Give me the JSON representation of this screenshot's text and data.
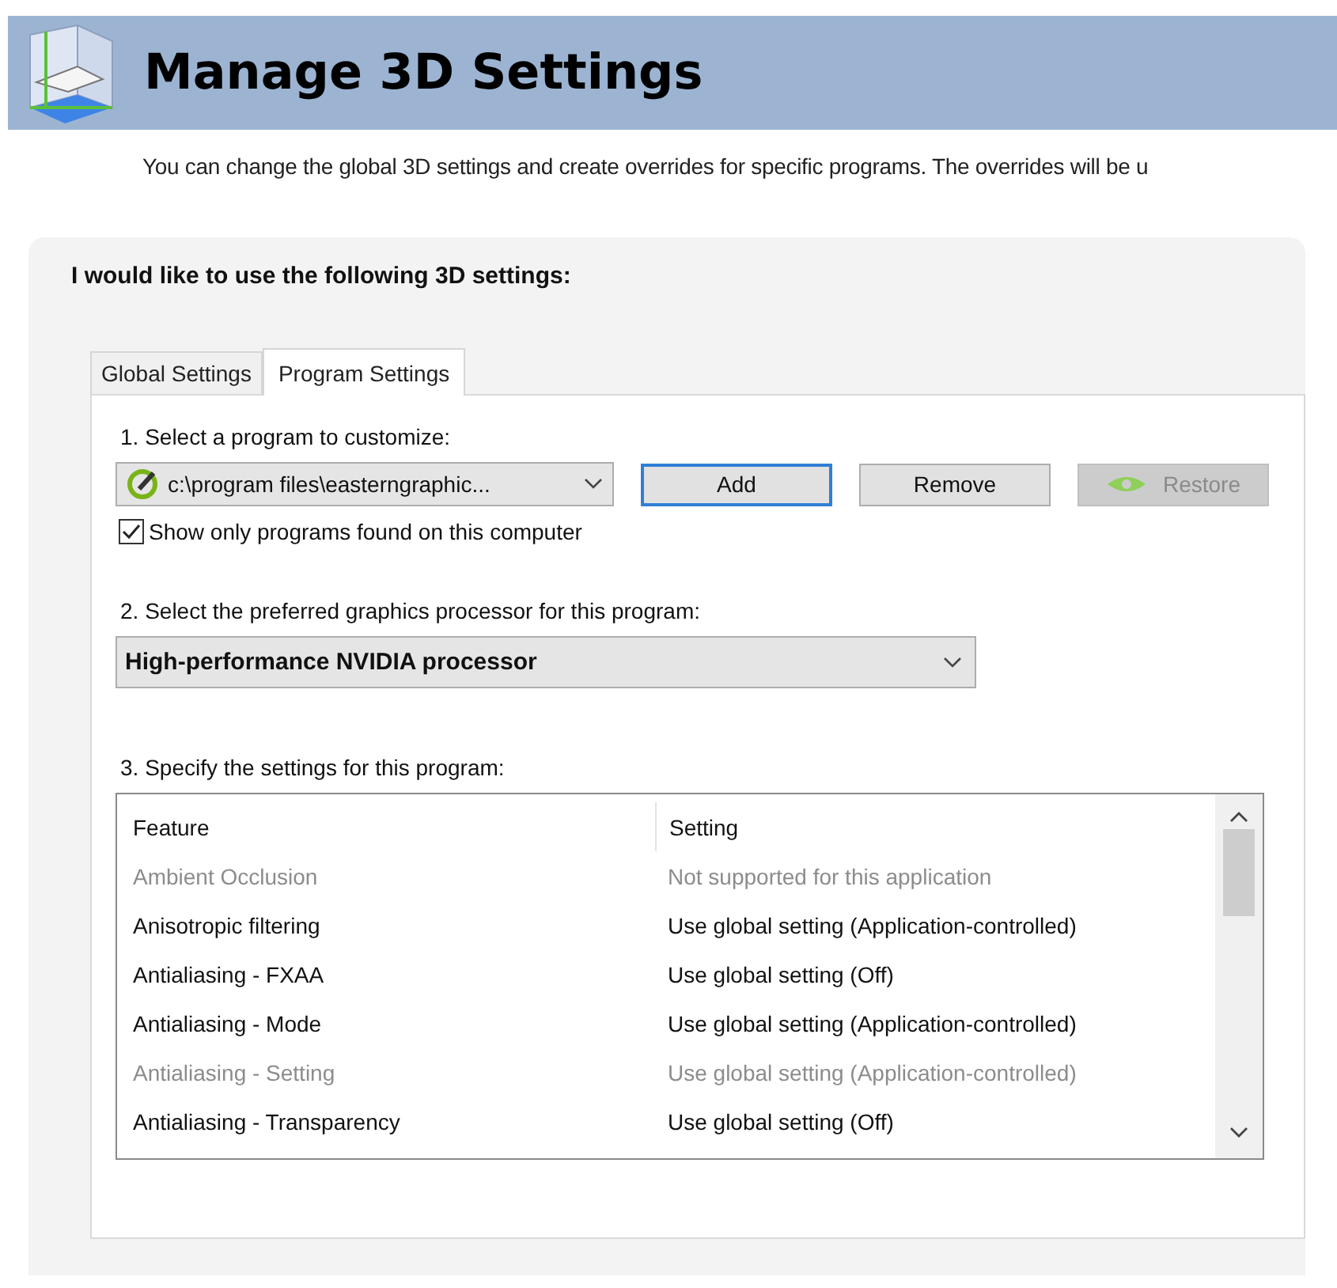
{
  "header": {
    "title": "Manage 3D Settings",
    "description": "You can change the global 3D settings and create overrides for specific programs. The overrides will be u"
  },
  "panel": {
    "heading": "I would like to use the following 3D settings:",
    "tabs": [
      {
        "label": "Global Settings",
        "selected": false
      },
      {
        "label": "Program Settings",
        "selected": true
      }
    ],
    "step1": {
      "label": "1. Select a program to customize:",
      "program": "c:\\program files\\easterngraphic...",
      "buttons": [
        {
          "label": "Add",
          "kind": "default",
          "disabled": false
        },
        {
          "label": "Remove",
          "kind": "normal",
          "disabled": false
        },
        {
          "label": "Restore",
          "kind": "icon",
          "disabled": true
        }
      ],
      "checkbox": {
        "label": "Show only programs found on this computer",
        "checked": true
      }
    },
    "step2": {
      "label": "2. Select the preferred graphics processor for this program:",
      "value": "High-performance NVIDIA processor"
    },
    "step3": {
      "label": "3. Specify the settings for this program:",
      "columns": [
        "Feature",
        "Setting"
      ],
      "rows": [
        {
          "feature": "Ambient Occlusion",
          "setting": "Not supported for this application",
          "disabled": true
        },
        {
          "feature": "Anisotropic filtering",
          "setting": "Use global setting (Application-controlled)",
          "disabled": false
        },
        {
          "feature": "Antialiasing - FXAA",
          "setting": "Use global setting (Off)",
          "disabled": false
        },
        {
          "feature": "Antialiasing - Mode",
          "setting": "Use global setting (Application-controlled)",
          "disabled": false
        },
        {
          "feature": "Antialiasing - Setting",
          "setting": "Use global setting (Application-controlled)",
          "disabled": true
        },
        {
          "feature": "Antialiasing - Transparency",
          "setting": "Use global setting (Off)",
          "disabled": false
        }
      ]
    }
  }
}
